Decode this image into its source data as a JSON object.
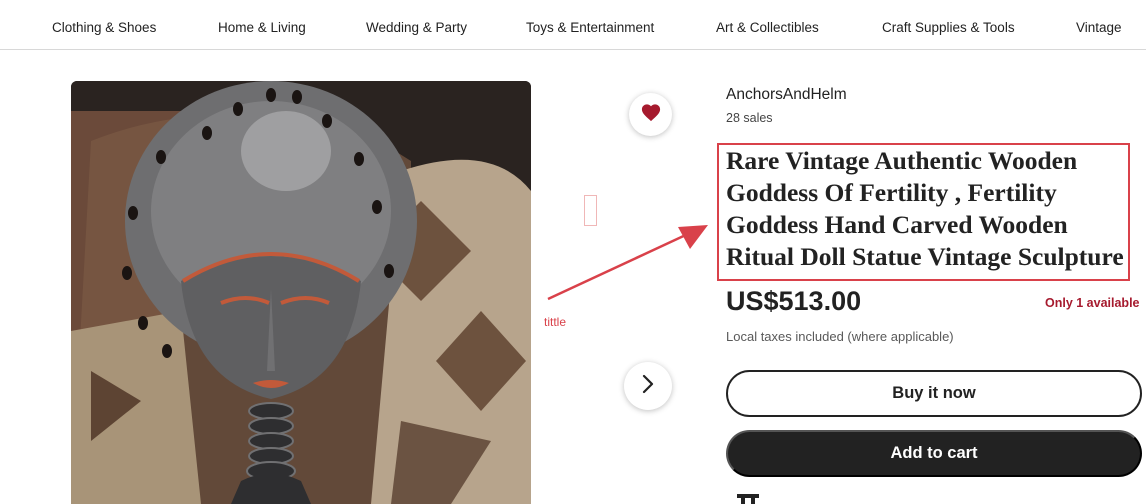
{
  "nav": {
    "items": [
      "Clothing & Shoes",
      "Home & Living",
      "Wedding & Party",
      "Toys & Entertainment",
      "Art & Collectibles",
      "Craft Supplies & Tools",
      "Vintage"
    ]
  },
  "listing": {
    "shop_name": "AnchorsAndHelm",
    "sales": "28 sales",
    "title": "Rare Vintage Authentic Wooden Goddess Of Fertility , Fertility Goddess Hand Carved Wooden Ritual Doll Statue Vintage Sculpture",
    "price": "US$513.00",
    "availability": "Only 1 available",
    "tax_note": "Local taxes included (where applicable)"
  },
  "actions": {
    "buy_now": "Buy it now",
    "add_to_cart": "Add to cart"
  },
  "annotation": {
    "label": "tittle",
    "color": "#d9414a"
  },
  "icons": {
    "favorite": "heart-icon",
    "next": "chevron-right-icon"
  },
  "colors": {
    "heart": "#a61a2e",
    "availability": "#a61a2e",
    "cart_button": "#222222"
  }
}
